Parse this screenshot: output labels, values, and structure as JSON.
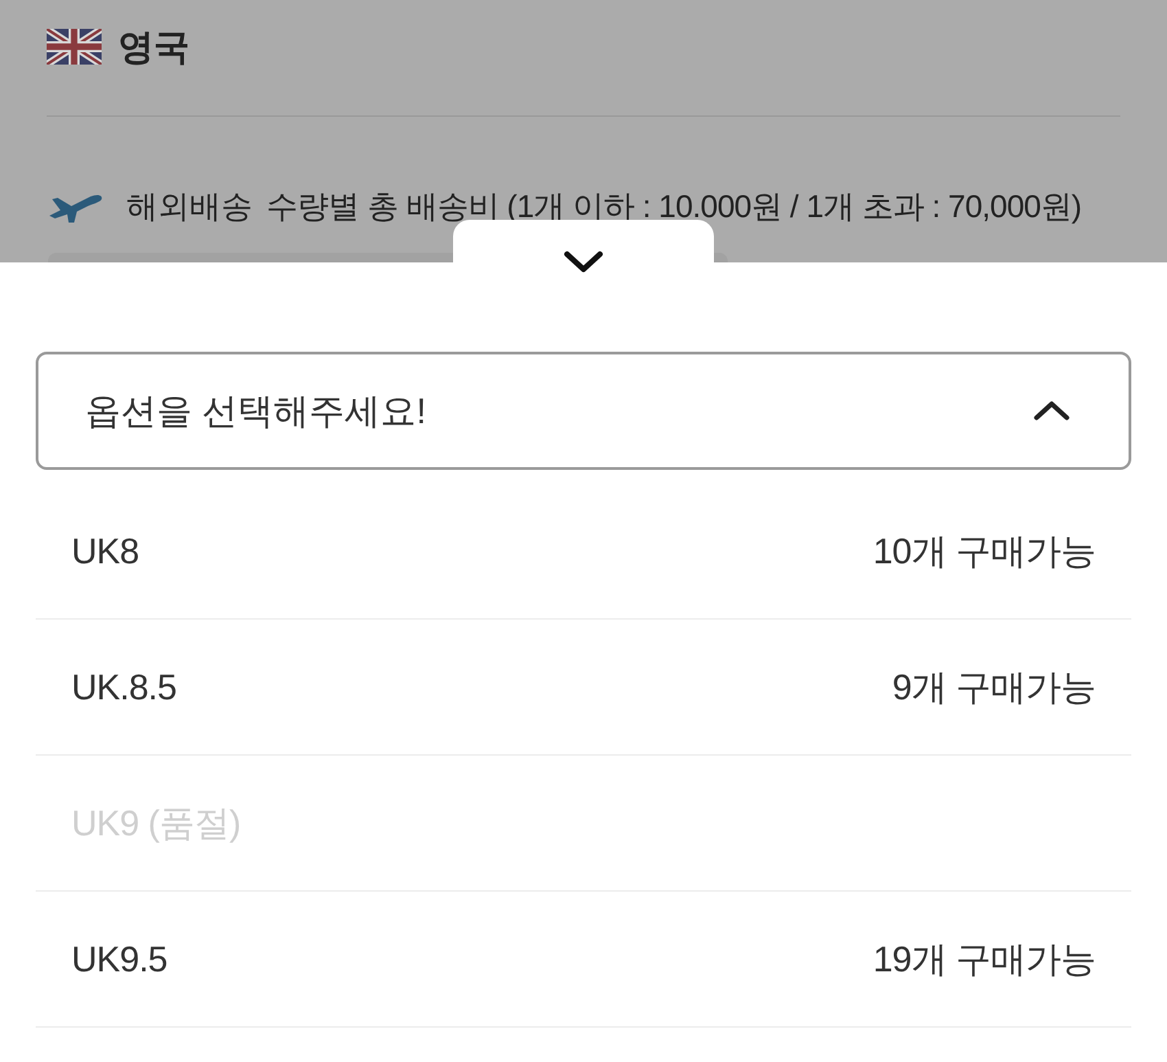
{
  "background": {
    "country": {
      "name": "영국"
    },
    "shipping": {
      "label": "해외배송",
      "text": "수량별 총 배송비 (1개 이하 : 10.000원 / 1개 초과 : 70,000원)"
    }
  },
  "sheet": {
    "select": {
      "placeholder": "옵션을 선택해주세요!",
      "expanded": true
    },
    "options": [
      {
        "label": "UK8",
        "stock": "10개 구매가능",
        "disabled": false
      },
      {
        "label": "UK.8.5",
        "stock": "9개 구매가능",
        "disabled": false
      },
      {
        "label": "UK9 (품절)",
        "disabled": true
      },
      {
        "label": "UK9.5",
        "stock": "19개 구매가능",
        "disabled": false
      }
    ]
  }
}
